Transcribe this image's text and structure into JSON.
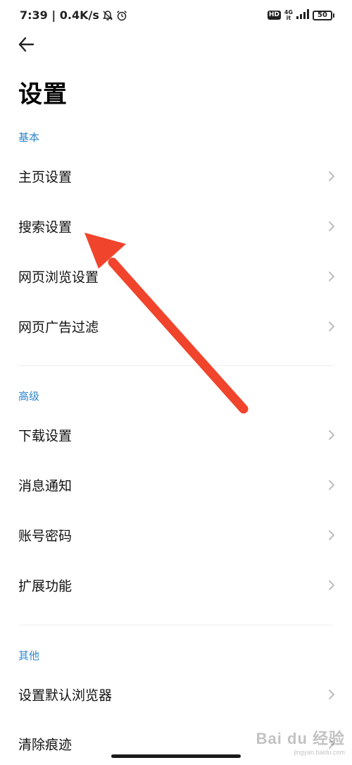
{
  "status_bar": {
    "time_speed": "7:39 | 0.4K/s",
    "hd": "HD",
    "network_top": "4G",
    "network_bottom": "it",
    "battery": "50"
  },
  "header": {
    "title": "设置"
  },
  "sections": [
    {
      "label": "基本",
      "items": [
        {
          "label": "主页设置"
        },
        {
          "label": "搜索设置"
        },
        {
          "label": "网页浏览设置"
        },
        {
          "label": "网页广告过滤"
        }
      ]
    },
    {
      "label": "高级",
      "items": [
        {
          "label": "下载设置"
        },
        {
          "label": "消息通知"
        },
        {
          "label": "账号密码"
        },
        {
          "label": "扩展功能"
        }
      ]
    },
    {
      "label": "其他",
      "items": [
        {
          "label": "设置默认浏览器"
        },
        {
          "label": "清除痕迹"
        }
      ]
    }
  ],
  "watermark": {
    "main": "Bai du 经验",
    "sub": "jingyan.baidu.com"
  },
  "colors": {
    "accent": "#2f86cf",
    "annotation_arrow": "#f0442c"
  }
}
